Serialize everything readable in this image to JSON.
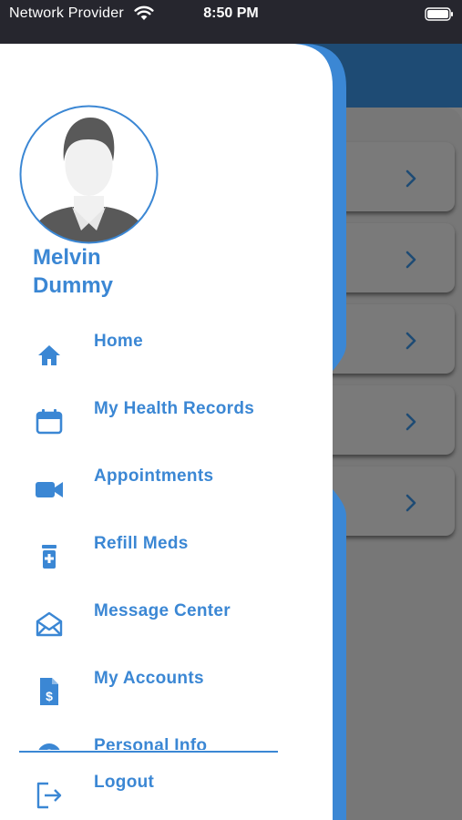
{
  "status_bar": {
    "carrier": "Network Provider",
    "time": "8:50 PM"
  },
  "user": {
    "first_name": "Melvin",
    "last_name": "Dummy"
  },
  "menu": [
    {
      "label": "Home",
      "icon": "home-icon"
    },
    {
      "label": "My Health Records",
      "icon": "calendar-icon"
    },
    {
      "label": "Appointments",
      "icon": "video-camera-icon"
    },
    {
      "label": "Refill Meds",
      "icon": "pill-bottle-icon"
    },
    {
      "label": "Message Center",
      "icon": "envelope-icon"
    },
    {
      "label": "My Accounts",
      "icon": "invoice-icon"
    },
    {
      "label": "Personal Info",
      "icon": "person-icon"
    }
  ],
  "logout": {
    "label": "Logout",
    "icon": "logout-icon"
  },
  "colors": {
    "accent": "#3b87d4",
    "header": "#1e4b74",
    "overlay": "#777777",
    "status_bar": "#26262e"
  }
}
